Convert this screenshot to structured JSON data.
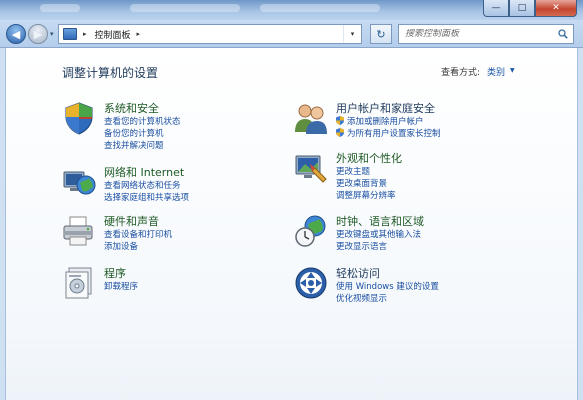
{
  "window": {
    "buttons": {
      "minimize": "—",
      "maximize": "□",
      "close": "✕"
    }
  },
  "nav": {
    "back_label": "◀",
    "forward_label": "▶",
    "history_label": "▾"
  },
  "address": {
    "separator": "▸",
    "path": "控制面板",
    "separator2": "▸",
    "dropdown": "▾"
  },
  "refresh_label": "↻",
  "search": {
    "placeholder": "搜索控制面板"
  },
  "page": {
    "title": "调整计算机的设置",
    "view_by_label": "查看方式:",
    "view_by_value": "类别",
    "view_by_arrow": "▼"
  },
  "categories": [
    {
      "title": "系统和安全",
      "links": [
        "查看您的计算机状态",
        "备份您的计算机",
        "查找并解决问题"
      ]
    },
    {
      "title": "网络和 Internet",
      "links": [
        "查看网络状态和任务",
        "选择家庭组和共享选项"
      ]
    },
    {
      "title": "硬件和声音",
      "links": [
        "查看设备和打印机",
        "添加设备"
      ]
    },
    {
      "title": "程序",
      "links": [
        "卸载程序"
      ]
    },
    {
      "title": "用户帐户和家庭安全",
      "links": [
        "添加或删除用户帐户",
        "为所有用户设置家长控制"
      ]
    },
    {
      "title": "外观和个性化",
      "links": [
        "更改主题",
        "更改桌面背景",
        "调整屏幕分辨率"
      ]
    },
    {
      "title": "时钟、语言和区域",
      "links": [
        "更改键盘或其他输入法",
        "更改显示语言"
      ]
    },
    {
      "title": "轻松访问",
      "links": [
        "使用 Windows 建议的设置",
        "优化视频显示"
      ]
    }
  ],
  "colors": {
    "link": "#1a4fa0",
    "category_title": "#1e5a25",
    "title_bar": "#6f98c8"
  }
}
